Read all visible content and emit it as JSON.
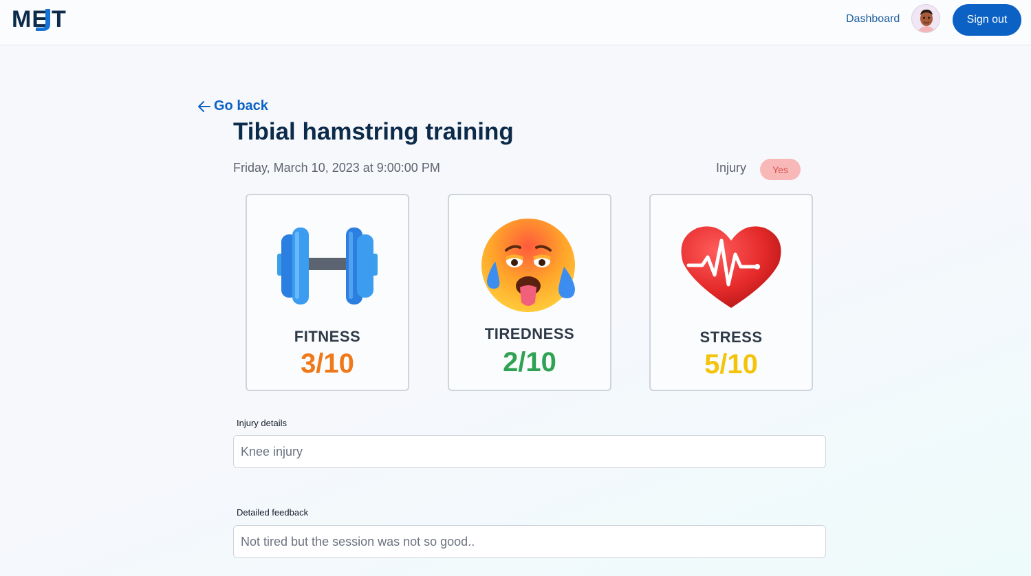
{
  "header": {
    "logo_text": "MEJT",
    "nav_dashboard": "Dashboard",
    "sign_out": "Sign out",
    "accent_color": "#0b62c4"
  },
  "main": {
    "go_back": "Go back",
    "title": "Tibial hamstring training",
    "date": "Friday, March 10, 2023 at 9:00:00 PM",
    "injury_label": "Injury",
    "injury_value": "Yes",
    "cards": [
      {
        "icon": "dumbbell-icon",
        "label": "FITNESS",
        "score": "3/10",
        "color": "#f07818"
      },
      {
        "icon": "tired-face-icon",
        "label": "TIREDNESS",
        "score": "2/10",
        "color": "#2fa353"
      },
      {
        "icon": "heart-pulse-icon",
        "label": "STRESS",
        "score": "5/10",
        "color": "#f2c40d"
      }
    ],
    "injury_details": {
      "label": "Injury details",
      "value": "Knee injury"
    },
    "feedback": {
      "label": "Detailed feedback",
      "value": "Not tired but the session was not so good.."
    }
  }
}
